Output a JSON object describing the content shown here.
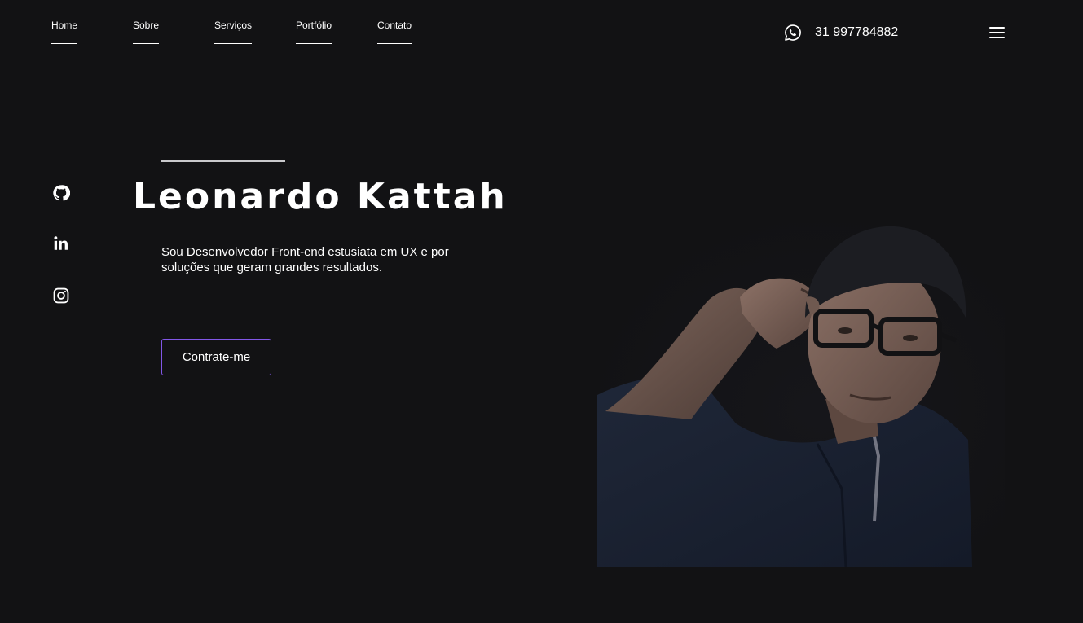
{
  "nav": {
    "items": [
      {
        "label": "Home"
      },
      {
        "label": "Sobre"
      },
      {
        "label": "Serviços"
      },
      {
        "label": "Portfólio"
      },
      {
        "label": "Contato"
      }
    ]
  },
  "contact": {
    "phone": "31 997784882",
    "icon": "whatsapp-icon"
  },
  "menu": {
    "icon": "hamburger-menu-icon"
  },
  "social": [
    {
      "icon": "github-icon"
    },
    {
      "icon": "linkedin-icon"
    },
    {
      "icon": "instagram-icon"
    }
  ],
  "hero": {
    "name": "Leonardo Kattah",
    "description": "Sou Desenvolvedor Front-end estusiata em UX e por soluções que geram grandes resultados.",
    "cta_label": "Contrate-me"
  },
  "colors": {
    "background": "#121214",
    "accent": "#8257e6",
    "text": "#ffffff"
  }
}
